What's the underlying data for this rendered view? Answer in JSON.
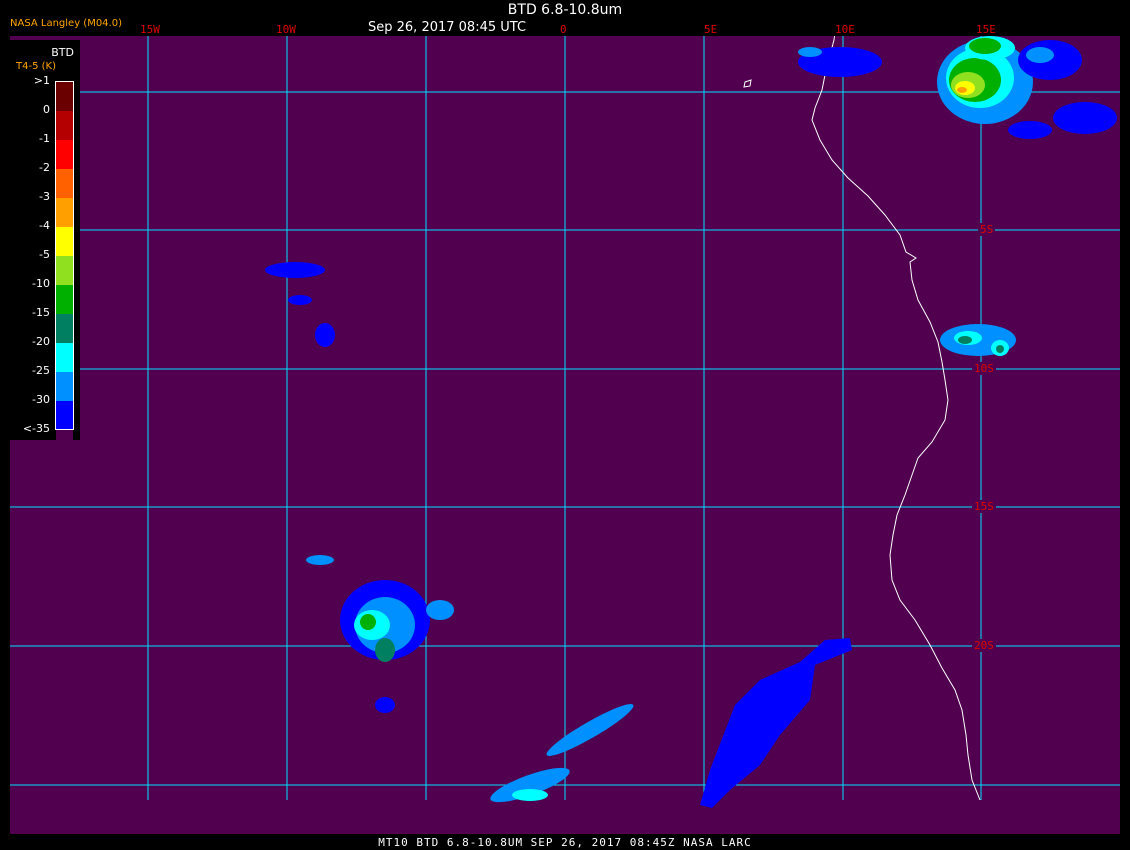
{
  "header": {
    "title": "BTD 6.8-10.8um",
    "subtitle": "Sep 26, 2017 08:45 UTC",
    "producer": "NASA Langley (M04.0)"
  },
  "footer": {
    "caption": "MT10  BTD 6.8-10.8UM   SEP 26, 2017 08:45Z   NASA LARC"
  },
  "legend": {
    "title": "BTD",
    "units": "T4-5 (K)",
    "labels": [
      ">1",
      "0",
      "-1",
      "-2",
      "-3",
      "-4",
      "-5",
      "-10",
      "-15",
      "-20",
      "-25",
      "-30",
      "<-35"
    ],
    "colors": [
      "#6b0000",
      "#b40000",
      "#ff0000",
      "#ff6000",
      "#ffa000",
      "#ffff00",
      "#90e020",
      "#00b000",
      "#008060",
      "#00ffff",
      "#0090ff",
      "#0000ff",
      "#50004f"
    ]
  },
  "grid": {
    "lon_labels": [
      "15W",
      "10W",
      "0",
      "5E",
      "10E",
      "15E"
    ],
    "lat_labels": [
      "5S",
      "10S",
      "15S",
      "20S"
    ]
  },
  "colors": {
    "background": "#50004f",
    "gridline": "#00e0ff",
    "coastline": "#ffffff",
    "grid_label": "#d00000"
  }
}
